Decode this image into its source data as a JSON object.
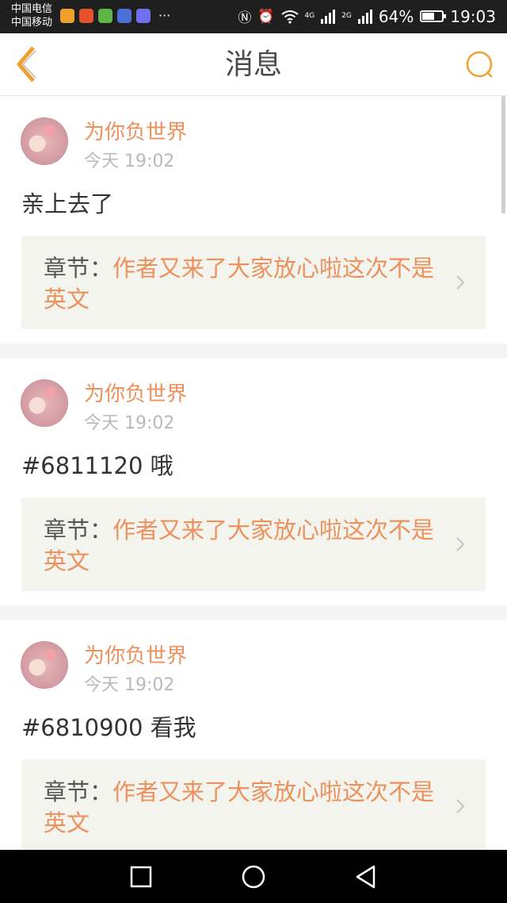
{
  "status_bar": {
    "carrier_1": "中国电信",
    "carrier_2": "中国移动",
    "app_icons": [
      {
        "name": "qq-browser-icon",
        "color": "#f0a02a"
      },
      {
        "name": "video-app-icon",
        "color": "#e4532c"
      },
      {
        "name": "chat-app-icon",
        "color": "#5db546"
      },
      {
        "name": "music-app-icon",
        "color": "#4c6fd8"
      },
      {
        "name": "media-app-icon",
        "color": "#6f6ff0"
      }
    ],
    "more": "···",
    "network_4g": "4G",
    "network_2g": "2G",
    "battery": "64%",
    "battery_level": 0.64,
    "time": "19:03"
  },
  "header": {
    "title": "消息",
    "accent_color": "#f0a030"
  },
  "messages": [
    {
      "username": "为你负世界",
      "time": "今天 19:02",
      "text": "亲上去了",
      "chapter_label": "章节：",
      "chapter_title": "作者又来了大家放心啦这次不是英文"
    },
    {
      "username": "为你负世界",
      "time": "今天 19:02",
      "text": "#6811120 哦",
      "chapter_label": "章节：",
      "chapter_title": "作者又来了大家放心啦这次不是英文"
    },
    {
      "username": "为你负世界",
      "time": "今天 19:02",
      "text": "#6810900 看我",
      "chapter_label": "章节：",
      "chapter_title": "作者又来了大家放心啦这次不是英文"
    }
  ],
  "colors": {
    "username": "#ec915b",
    "chapter_title": "#ec915b",
    "timestamp": "#b9b9b9"
  }
}
